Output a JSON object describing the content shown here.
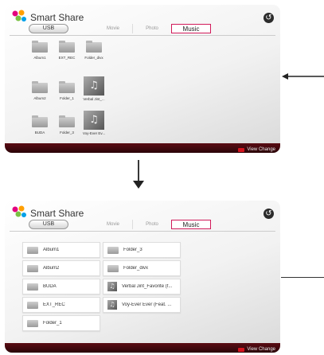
{
  "app": {
    "title": "Smart Share"
  },
  "colors": {
    "accent": "#d11a5a",
    "bottom_bar": "#3a0810",
    "hint_key": "#d4141e"
  },
  "header": {
    "logo_icon": "smart-share-logo",
    "back_icon": "back-icon",
    "back_glyph": "↺"
  },
  "source_button": {
    "label": "USB"
  },
  "tabs": [
    {
      "label": "Movie",
      "active": false
    },
    {
      "label": "Photo",
      "active": false
    },
    {
      "label": "Music",
      "active": true
    }
  ],
  "bottom_hint": {
    "label": "View Change",
    "key_color": "red"
  },
  "grid_view": {
    "items": [
      {
        "label": "Album1",
        "type": "folder"
      },
      {
        "label": "EXT_REC",
        "type": "folder"
      },
      {
        "label": "Folder_divx",
        "type": "folder"
      },
      {
        "label": "Album2",
        "type": "folder"
      },
      {
        "label": "Folder_1",
        "type": "folder"
      },
      {
        "label": "Verbal Jint_...",
        "type": "music"
      },
      {
        "label": "BUDA",
        "type": "folder"
      },
      {
        "label": "Folder_3",
        "type": "folder"
      },
      {
        "label": "Voy-Ever Ev...",
        "type": "music"
      }
    ]
  },
  "list_view": {
    "items": [
      {
        "label": "Album1",
        "type": "folder"
      },
      {
        "label": "Folder_3",
        "type": "folder"
      },
      {
        "label": "Album2",
        "type": "folder"
      },
      {
        "label": "Folder_divx",
        "type": "folder"
      },
      {
        "label": "BUDA",
        "type": "folder"
      },
      {
        "label": "Verbal Jint_Favorite (f...",
        "type": "music"
      },
      {
        "label": "EXT_REC",
        "type": "folder"
      },
      {
        "label": "Voy-Ever Ever (Feat. ...",
        "type": "music"
      },
      {
        "label": "Folder_1",
        "type": "folder"
      }
    ]
  },
  "music_glyph": "♫"
}
